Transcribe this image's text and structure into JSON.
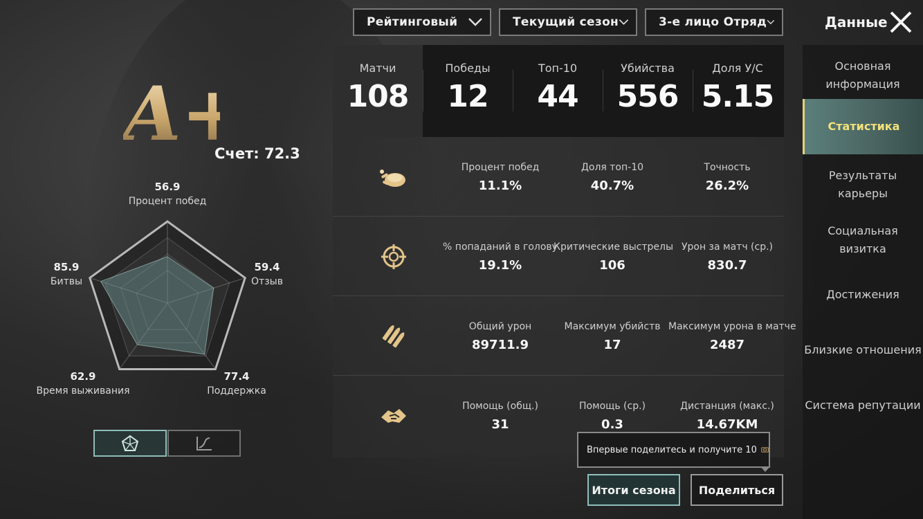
{
  "filters": {
    "mode": "Рейтинговый",
    "season": "Текущий сезон",
    "team": "3-е лицо Отряд"
  },
  "header": {
    "title": "Данные"
  },
  "grade": {
    "value": "A+",
    "score_text": "Счет: 72.3"
  },
  "radar": {
    "points": [
      {
        "key": "win",
        "value": "56.9",
        "label": "Процент побед",
        "level": 0.569
      },
      {
        "key": "feedback",
        "value": "59.4",
        "label": "Отзыв",
        "level": 0.594
      },
      {
        "key": "support",
        "value": "77.4",
        "label": "Поддержка",
        "level": 0.774
      },
      {
        "key": "survival",
        "value": "62.9",
        "label": "Время выживания",
        "level": 0.629
      },
      {
        "key": "battles",
        "value": "85.9",
        "label": "Битвы",
        "level": 0.859
      }
    ]
  },
  "summary": [
    {
      "label": "Матчи",
      "value": "108"
    },
    {
      "label": "Победы",
      "value": "12"
    },
    {
      "label": "Топ-10",
      "value": "44"
    },
    {
      "label": "Убийства",
      "value": "556"
    },
    {
      "label": "Доля У/С",
      "value": "5.15"
    }
  ],
  "rows": [
    {
      "icon": "chicken-icon",
      "cells": [
        {
          "label": "Процент побед",
          "value": "11.1%"
        },
        {
          "label": "Доля топ-10",
          "value": "40.7%"
        },
        {
          "label": "Точность",
          "value": "26.2%"
        }
      ]
    },
    {
      "icon": "crosshair-icon",
      "cells": [
        {
          "label": "% попаданий в голову",
          "value": "19.1%"
        },
        {
          "label": "Критические выстрелы",
          "value": "106"
        },
        {
          "label": "Урон за матч (ср.)",
          "value": "830.7"
        }
      ]
    },
    {
      "icon": "bullets-icon",
      "cells": [
        {
          "label": "Общий урон",
          "value": "89711.9"
        },
        {
          "label": "Максимум убийств",
          "value": "17"
        },
        {
          "label": "Максимум урона в матче",
          "value": "2487"
        }
      ]
    },
    {
      "icon": "handshake-icon",
      "cells": [
        {
          "label": "Помощь (общ.)",
          "value": "31"
        },
        {
          "label": "Помощь (ср.)",
          "value": "0.3"
        },
        {
          "label": "Дистанция (макс.)",
          "value": "14.67KM"
        }
      ]
    }
  ],
  "sidebar": {
    "items": [
      {
        "label": "Основная информация"
      },
      {
        "label": "Статистика",
        "active": true
      },
      {
        "label": "Результаты карьеры"
      },
      {
        "label": "Социальная визитка"
      },
      {
        "label": "Достижения"
      },
      {
        "label": "Близкие отношения"
      },
      {
        "label": "Система репутации"
      }
    ]
  },
  "tooltip": {
    "text": "Впервые поделитесь и получите 10"
  },
  "buttons": {
    "season_summary": "Итоги сезона",
    "share": "Поделиться"
  },
  "colors": {
    "accent": "#8ec0bb",
    "active_text": "#f3e27b",
    "gold": "#c9a66b"
  }
}
